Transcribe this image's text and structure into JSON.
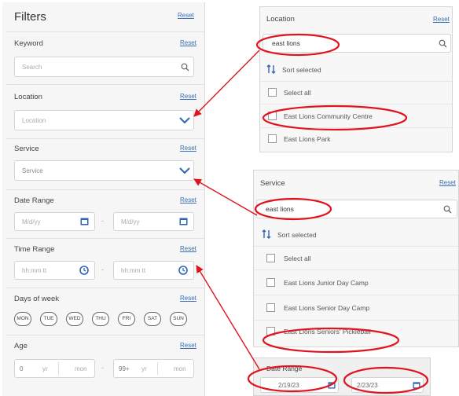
{
  "filters": {
    "title": "Filters",
    "reset": "Reset",
    "keyword": {
      "label": "Keyword",
      "placeholder": "Search"
    },
    "location": {
      "label": "Location",
      "value": "Location"
    },
    "service": {
      "label": "Service",
      "value": "Service"
    },
    "date_range": {
      "label": "Date Range",
      "from": "M/d/yy",
      "to": "M/d/yy",
      "sep": "-"
    },
    "time_range": {
      "label": "Time Range",
      "from": "hh:mm tt",
      "to": "hh:mm tt",
      "sep": "-"
    },
    "days_of_week": {
      "label": "Days of week",
      "days": [
        "MON",
        "TUE",
        "WED",
        "THU",
        "FRI",
        "SAT",
        "SUN"
      ]
    },
    "age": {
      "label": "Age",
      "from_value": "0",
      "from_unit": "yr",
      "from_month": "mon",
      "sep": "-",
      "to_value": "99+",
      "to_unit": "yr",
      "to_month": "mon"
    }
  },
  "location_popup": {
    "title": "Location",
    "reset": "Reset",
    "search_value": "east lions",
    "sort_label": "Sort selected",
    "select_all": "Select all",
    "items": [
      "East Lions Community Centre",
      "East Lions Park"
    ]
  },
  "service_popup": {
    "title": "Service",
    "reset": "Reset",
    "search_value": "east lions",
    "sort_label": "Sort selected",
    "select_all": "Select all",
    "items": [
      "East Lions Junior Day Camp",
      "East Lions Senior Day Camp",
      "East Lions Seniors' Pickleball"
    ]
  },
  "date_popup": {
    "label": "Date Range",
    "from": "2/19/23",
    "to": "2/23/23"
  },
  "annotation_color": "#e0141e"
}
